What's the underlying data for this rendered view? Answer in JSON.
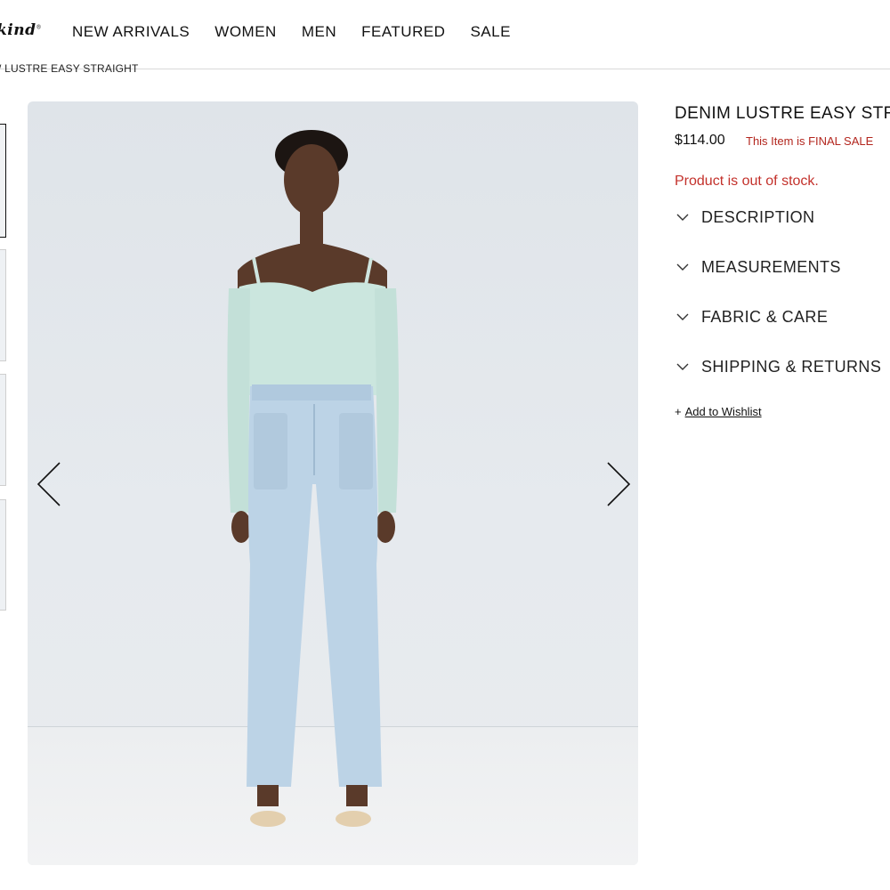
{
  "brand": {
    "logo_text": "kind",
    "logo_mark": "®"
  },
  "nav": {
    "items": [
      {
        "label": "NEW ARRIVALS"
      },
      {
        "label": "WOMEN"
      },
      {
        "label": "MEN"
      },
      {
        "label": "FEATURED"
      },
      {
        "label": "SALE"
      }
    ]
  },
  "breadcrumb": {
    "text": "/ LUSTRE EASY STRAIGHT"
  },
  "gallery": {
    "thumbnail_count": 4,
    "active_index": 0,
    "arrow_prev_icon": "chevron-left-icon",
    "arrow_next_icon": "chevron-right-icon"
  },
  "product": {
    "title": "DENIM LUSTRE EASY STRA",
    "price": "$114.00",
    "final_sale_note": "This Item is FINAL SALE",
    "stock_status": "Product is out of stock.",
    "accordions": [
      {
        "label": "DESCRIPTION"
      },
      {
        "label": "MEASUREMENTS"
      },
      {
        "label": "FABRIC & CARE"
      },
      {
        "label": "SHIPPING & RETURNS"
      }
    ],
    "wishlist_prefix": "+",
    "wishlist_label": "Add to Wishlist"
  },
  "colors": {
    "sale_red": "#b3261e",
    "stock_red": "#c3312b",
    "text": "#111111"
  }
}
